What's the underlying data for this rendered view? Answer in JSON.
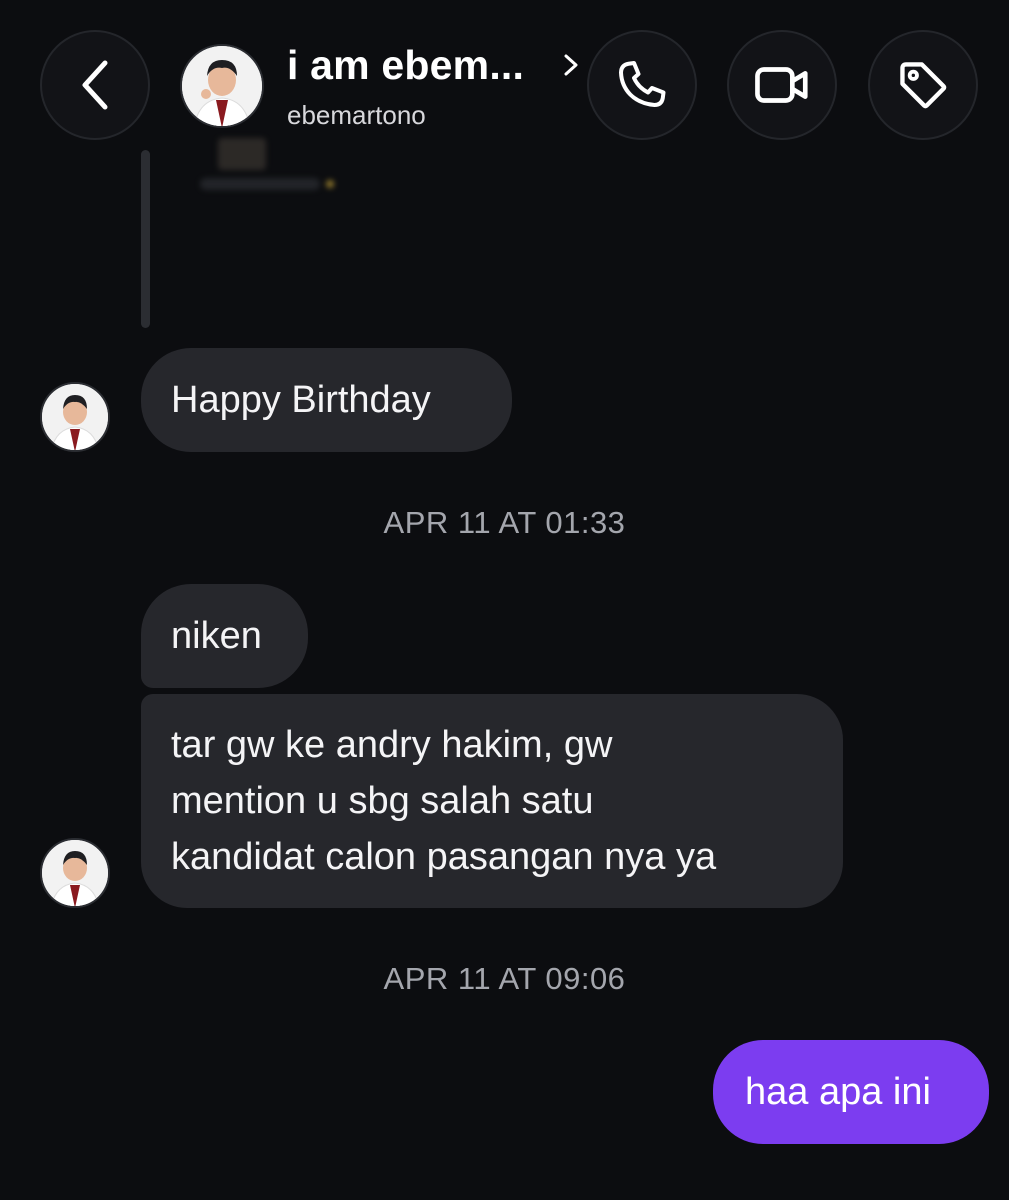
{
  "header": {
    "contact_name": "i am ebem...",
    "contact_handle": "ebemartono",
    "icons": [
      "chevron-left-icon",
      "chevron-right-icon",
      "phone-icon",
      "video-icon",
      "tag-icon"
    ]
  },
  "thread": {
    "messages": [
      {
        "from": "them",
        "text": "Happy Birthday"
      },
      {
        "from": "them",
        "text": "niken"
      },
      {
        "from": "them",
        "lines": [
          "tar gw ke andry hakim, gw",
          "mention u sbg salah satu",
          "kandidat calon pasangan nya ya"
        ]
      },
      {
        "from": "me",
        "text": "haa apa ini"
      }
    ],
    "timestamps": [
      "APR 11 AT 01:33",
      "APR 11 AT 09:06"
    ]
  },
  "colors": {
    "background": "#0c0d10",
    "incoming_bubble": "#26272c",
    "outgoing_bubble": "#7c3df0",
    "timestamp_text": "#a4a6ad"
  }
}
